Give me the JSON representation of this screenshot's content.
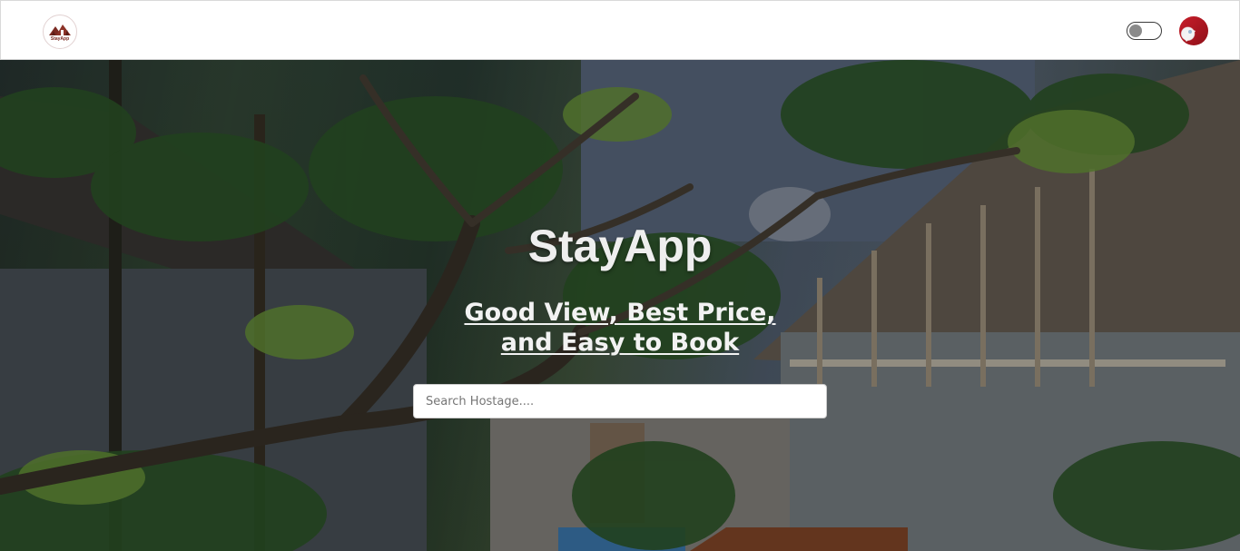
{
  "navbar": {
    "logo_text": "StayApp",
    "theme_toggle_on": false,
    "avatar_icon": "user-avatar-icon"
  },
  "hero": {
    "title": "StayApp",
    "subtitle": "Good View, Best Price, and Easy to Book",
    "search": {
      "placeholder": "Search Hostage....",
      "value": ""
    }
  },
  "colors": {
    "brand": "#7a2a22",
    "navbar_bg": "#ffffff",
    "hero_text": "#eeeeee"
  }
}
